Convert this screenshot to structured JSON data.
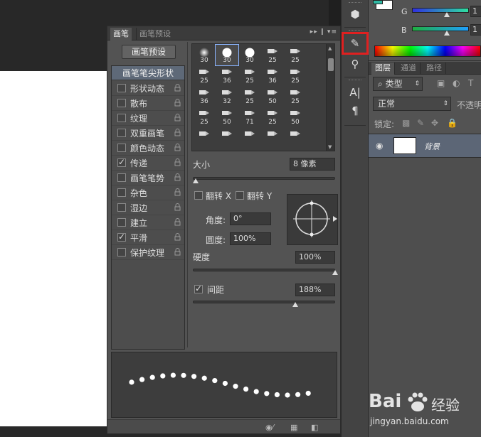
{
  "brush_panel": {
    "tabs": [
      {
        "label": "画笔",
        "active": true
      },
      {
        "label": "画笔预设",
        "active": false
      }
    ],
    "tab_controls": "▸▸ ‖ ▾≡",
    "preset_button": "画笔预设",
    "list_header": "画笔笔尖形状",
    "options": [
      {
        "label": "形状动态",
        "checked": false
      },
      {
        "label": "散布",
        "checked": false
      },
      {
        "label": "纹理",
        "checked": false
      },
      {
        "label": "双重画笔",
        "checked": false
      },
      {
        "label": "颜色动态",
        "checked": false
      },
      {
        "label": "传递",
        "checked": true
      },
      {
        "label": "画笔笔势",
        "checked": false
      },
      {
        "label": "杂色",
        "checked": false
      },
      {
        "label": "湿边",
        "checked": false
      },
      {
        "label": "建立",
        "checked": false
      },
      {
        "label": "平滑",
        "checked": true
      },
      {
        "label": "保护纹理",
        "checked": false
      }
    ],
    "tips": [
      {
        "n": "30",
        "shape": "soft"
      },
      {
        "n": "30",
        "shape": "hard",
        "selected": true
      },
      {
        "n": "30",
        "shape": "hard"
      },
      {
        "n": "25",
        "shape": "tool"
      },
      {
        "n": "25",
        "shape": "tool"
      },
      {
        "n": "25",
        "shape": "tool"
      },
      {
        "n": "36",
        "shape": "tool"
      },
      {
        "n": "25",
        "shape": "tool"
      },
      {
        "n": "36",
        "shape": "tool"
      },
      {
        "n": "25",
        "shape": "tool"
      },
      {
        "n": "36",
        "shape": "tool"
      },
      {
        "n": "32",
        "shape": "tool"
      },
      {
        "n": "25",
        "shape": "tool"
      },
      {
        "n": "50",
        "shape": "tool"
      },
      {
        "n": "25",
        "shape": "tool"
      },
      {
        "n": "25",
        "shape": "tool"
      },
      {
        "n": "50",
        "shape": "tool"
      },
      {
        "n": "71",
        "shape": "tool"
      },
      {
        "n": "25",
        "shape": "tool"
      },
      {
        "n": "50",
        "shape": "tool"
      },
      {
        "n": "",
        "shape": "tool"
      },
      {
        "n": "",
        "shape": "tool"
      },
      {
        "n": "",
        "shape": "tool"
      },
      {
        "n": "",
        "shape": "tool"
      },
      {
        "n": "",
        "shape": "tool"
      }
    ],
    "size_label": "大小",
    "size_value": "8 像素",
    "flip_x_label": "翻转 X",
    "flip_y_label": "翻转 Y",
    "angle_label": "角度:",
    "angle_value": "0°",
    "roundness_label": "圆度:",
    "roundness_value": "100%",
    "hardness_label": "硬度",
    "hardness_value": "100%",
    "spacing_label": "间距",
    "spacing_value": "188%",
    "spacing_checked": true,
    "size_slider": 0.02,
    "hardness_slider": 1.0,
    "spacing_slider": 0.72
  },
  "toolbar": {
    "icons": [
      "3d-cube-icon",
      "brush-panel-icon",
      "clone-source-icon",
      "character-icon",
      "paragraph-icon"
    ]
  },
  "color_panel": {
    "g_label": "G",
    "b_label": "B",
    "g_value": "1",
    "b_value": "1",
    "g_gradient": [
      "#2f2fe0",
      "#2fe0a0"
    ],
    "b_gradient": [
      "#1faf3f",
      "#1f9fff"
    ]
  },
  "layers_panel": {
    "tabs": [
      "图层",
      "通道",
      "路径"
    ],
    "filter_kind": "类型",
    "blend_mode": "正常",
    "opacity_label": "不透明",
    "lock_label": "锁定:",
    "layer_name": "背景"
  },
  "watermark": {
    "brand": "Bai",
    "brand_suffix": "经验",
    "url": "jingyan.baidu.com"
  }
}
